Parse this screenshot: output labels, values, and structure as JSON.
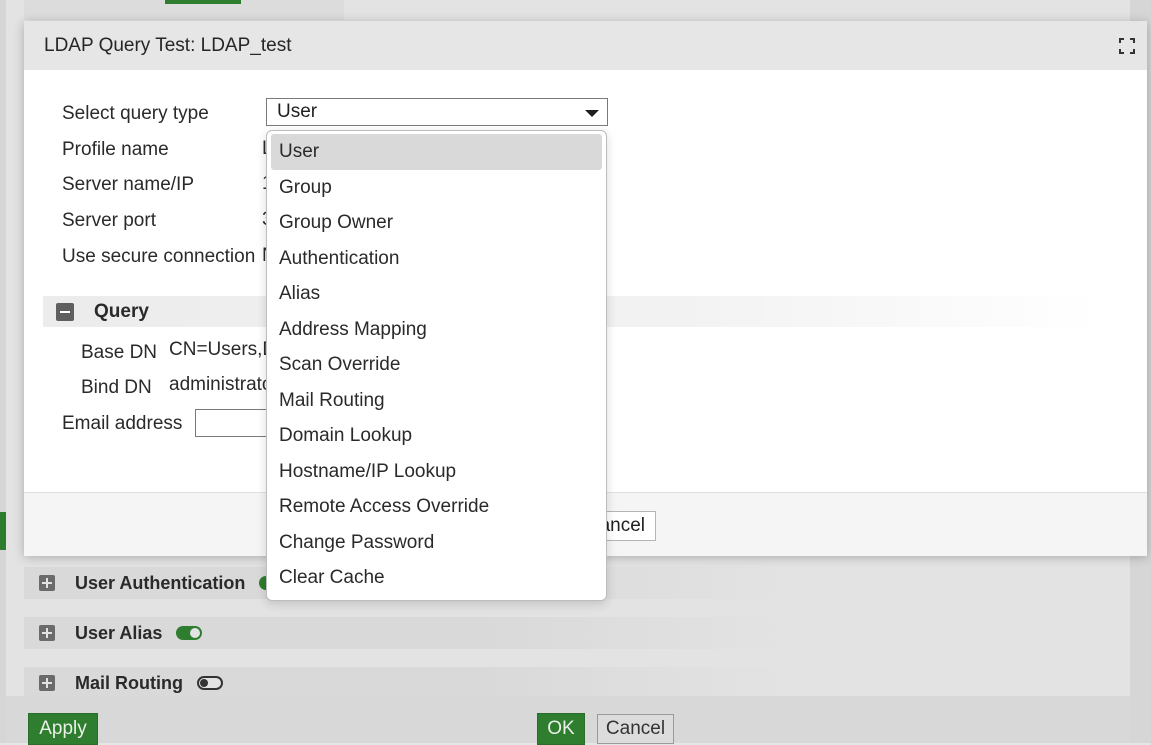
{
  "modal": {
    "title": "LDAP Query Test: LDAP_test",
    "fields": [
      {
        "label": "Select query type"
      },
      {
        "label": "Profile name",
        "value": "L"
      },
      {
        "label": "Server name/IP",
        "value": "1"
      },
      {
        "label": "Server port",
        "value": "3"
      },
      {
        "label": "Use secure connection",
        "value": "N"
      }
    ],
    "select": {
      "value": "User"
    },
    "query_section": {
      "title": "Query",
      "base_dn_label": "Base DN",
      "base_dn_value": "CN=Users,D",
      "bind_dn_label": "Bind DN",
      "bind_dn_value": "administrato",
      "email_label": "Email address"
    },
    "footer": {
      "cancel_label": "ancel"
    }
  },
  "dropdown": {
    "options": [
      "User",
      "Group",
      "Group Owner",
      "Authentication",
      "Alias",
      "Address Mapping",
      "Scan Override",
      "Mail Routing",
      "Domain Lookup",
      "Hostname/IP Lookup",
      "Remote Access Override",
      "Change Password",
      "Clear Cache"
    ],
    "selected_index": 0
  },
  "background": {
    "sections": [
      {
        "label": "User Authentication",
        "toggle": "on"
      },
      {
        "label": "User Alias",
        "toggle": "on"
      },
      {
        "label": "Mail Routing",
        "toggle": "off"
      }
    ],
    "apply_label": "Apply",
    "ok_label": "OK",
    "cancel_label": "Cancel"
  },
  "colors": {
    "accent_green": "#2f7d2f",
    "selected_item_bg": "#d9d9d9",
    "header_bg": "#e6e6e6"
  }
}
